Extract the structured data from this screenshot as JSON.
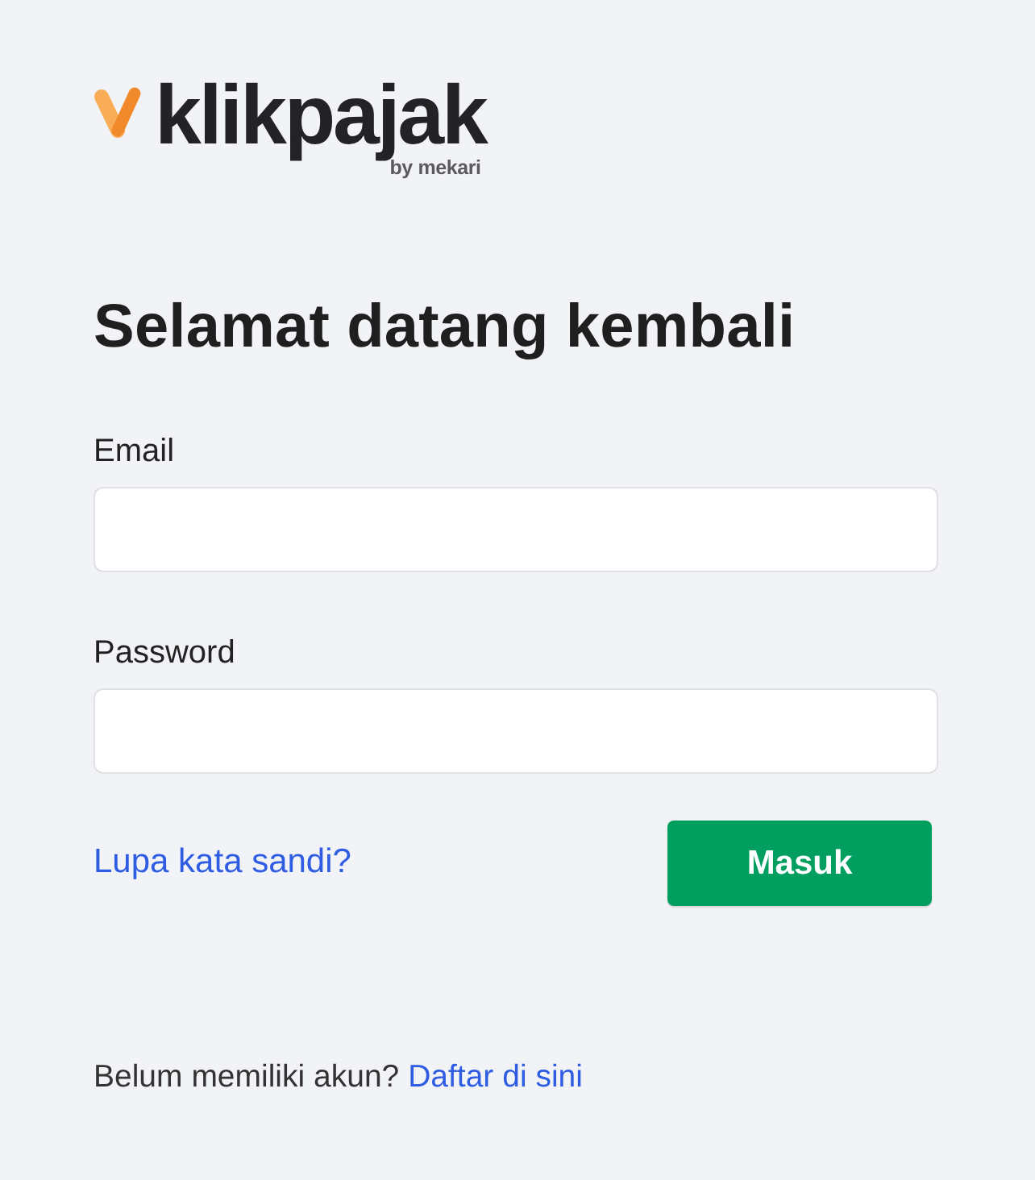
{
  "logo": {
    "wordmark": "klikpajak",
    "byline": "by mekari"
  },
  "title": "Selamat datang kembali",
  "fields": [
    {
      "label": "Email"
    },
    {
      "label": "Password"
    }
  ],
  "forgot_link": "Lupa kata sandi?",
  "submit_button": "Masuk",
  "signup": {
    "prompt": "Belum memiliki akun?",
    "link": "Daftar di sini"
  }
}
